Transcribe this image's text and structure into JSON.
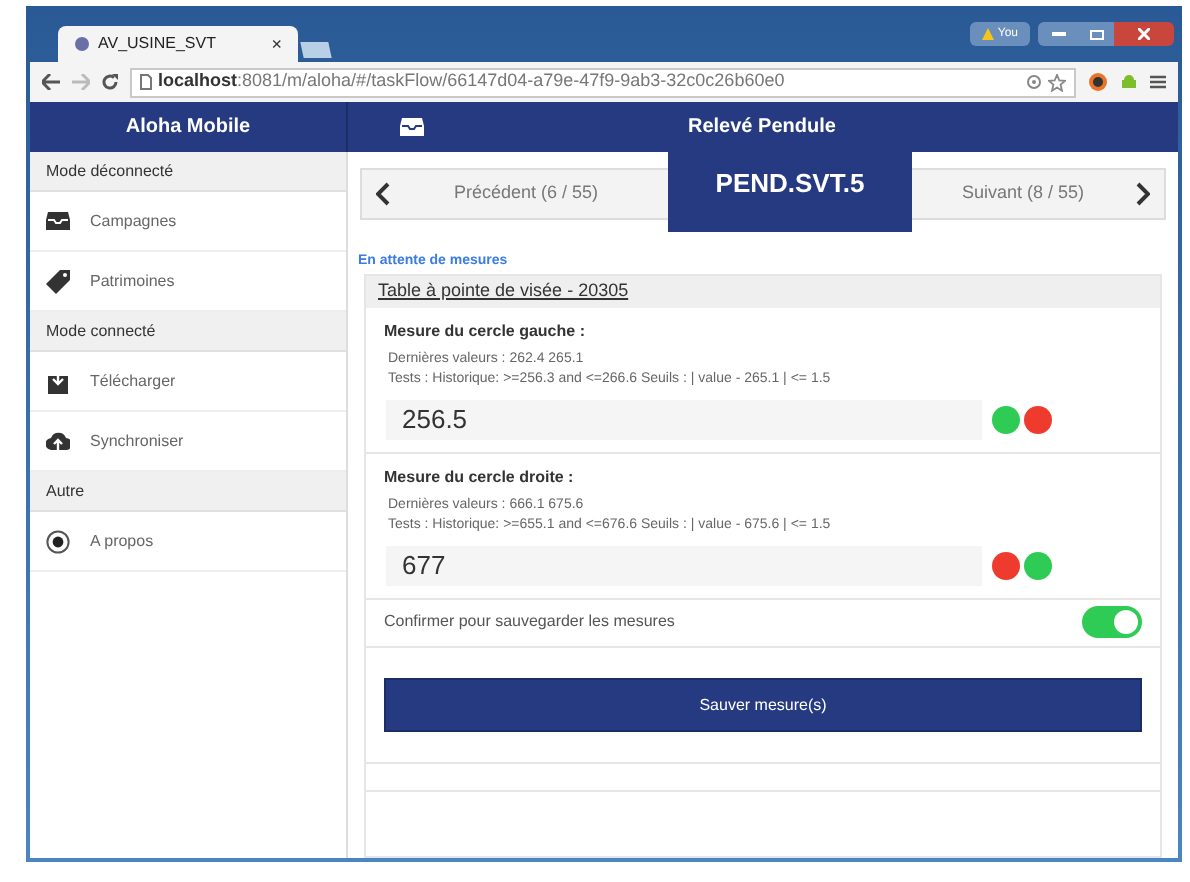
{
  "browser": {
    "tab_title": "AV_USINE_SVT",
    "tab_close": "×",
    "warning_label": "You",
    "url_host": "localhost",
    "url_path": ":8081/m/aloha/#/taskFlow/66147d04-a79e-47f9-9ab3-32c0c26b60e0"
  },
  "header": {
    "app_title": "Aloha Mobile",
    "page_title": "Relevé Pendule"
  },
  "sidebar": {
    "sections": [
      {
        "title": "Mode déconnecté",
        "items": [
          {
            "label": "Campagnes"
          },
          {
            "label": "Patrimoines"
          }
        ]
      },
      {
        "title": "Mode connecté",
        "items": [
          {
            "label": "Télécharger"
          },
          {
            "label": "Synchroniser"
          }
        ]
      },
      {
        "title": "Autre",
        "items": [
          {
            "label": "A propos"
          }
        ]
      }
    ]
  },
  "navigator": {
    "previous": "Précédent (6 / 55)",
    "current": "PEND.SVT.5",
    "next": "Suivant (8 / 55)"
  },
  "status": "En attente de mesures",
  "equipment": "Table à pointe de visée - 20305",
  "measures": [
    {
      "title": "Mesure du cercle gauche :",
      "last_values": "Dernières valeurs :  262.4  265.1",
      "tests": "Tests :  Historique: >=256.3 and <=266.6   Seuils : | value - 265.1 | <= 1.5",
      "value": "256.5",
      "indicators": [
        {
          "color": "#2ecc55"
        },
        {
          "color": "#ee3b2e"
        }
      ]
    },
    {
      "title": "Mesure du cercle droite :",
      "last_values": "Dernières valeurs :  666.1  675.6",
      "tests": "Tests :  Historique: >=655.1 and <=676.6   Seuils : | value - 675.6 | <= 1.5",
      "value": "677",
      "indicators": [
        {
          "color": "#ee3b2e"
        },
        {
          "color": "#2ecc55"
        }
      ]
    }
  ],
  "confirm": {
    "label": "Confirmer pour sauvegarder les mesures",
    "on": true
  },
  "save_button": "Sauver mesure(s)"
}
